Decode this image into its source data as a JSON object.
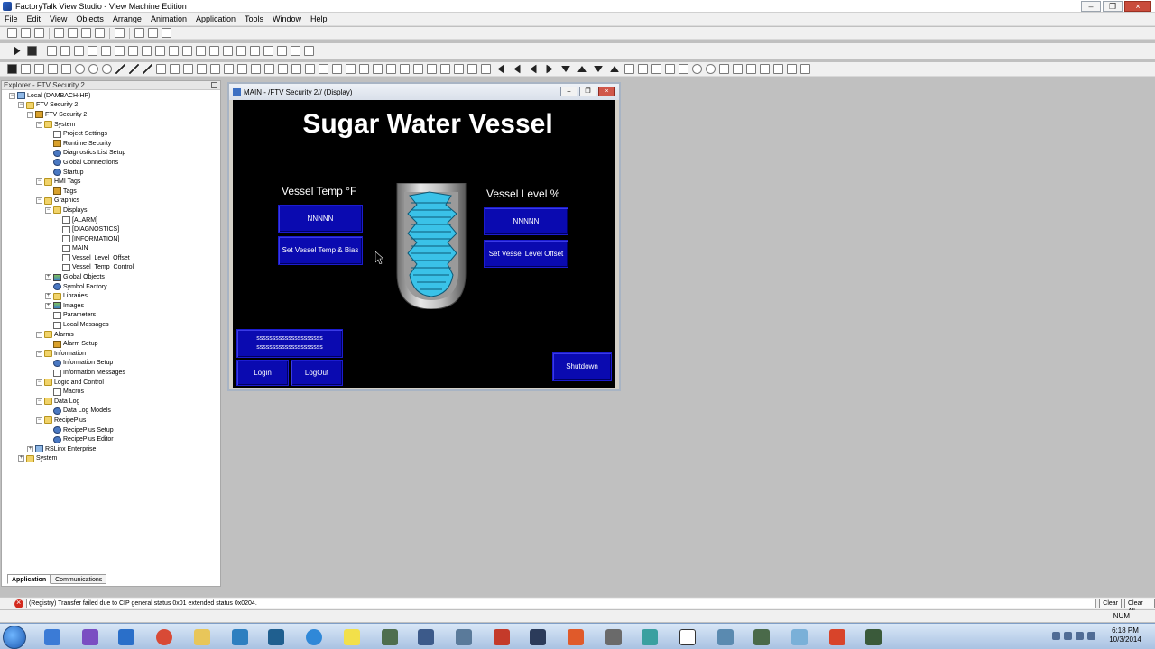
{
  "window": {
    "title": "FactoryTalk View Studio - View Machine Edition"
  },
  "menu": [
    "File",
    "Edit",
    "View",
    "Objects",
    "Arrange",
    "Animation",
    "Application",
    "Tools",
    "Window",
    "Help"
  ],
  "explorer": {
    "title": "Explorer - FTV Security 2",
    "tree": [
      {
        "label": "Local (DAMBACH-HP)",
        "depth": 0,
        "icon": "pc",
        "expander": "-"
      },
      {
        "label": "FTV Security 2",
        "depth": 1,
        "icon": "folder",
        "expander": "-"
      },
      {
        "label": "FTV Security 2",
        "depth": 2,
        "icon": "key",
        "expander": "-"
      },
      {
        "label": "System",
        "depth": 3,
        "icon": "folder",
        "expander": "-"
      },
      {
        "label": "Project Settings",
        "depth": 4,
        "icon": "doc",
        "expander": ""
      },
      {
        "label": "Runtime Security",
        "depth": 4,
        "icon": "key",
        "expander": ""
      },
      {
        "label": "Diagnostics List Setup",
        "depth": 4,
        "icon": "gear",
        "expander": ""
      },
      {
        "label": "Global Connections",
        "depth": 4,
        "icon": "gear",
        "expander": ""
      },
      {
        "label": "Startup",
        "depth": 4,
        "icon": "gear",
        "expander": ""
      },
      {
        "label": "HMI Tags",
        "depth": 3,
        "icon": "folder",
        "expander": "-"
      },
      {
        "label": "Tags",
        "depth": 4,
        "icon": "key",
        "expander": ""
      },
      {
        "label": "Graphics",
        "depth": 3,
        "icon": "folder",
        "expander": "-"
      },
      {
        "label": "Displays",
        "depth": 4,
        "icon": "folder",
        "expander": "-"
      },
      {
        "label": "[ALARM]",
        "depth": 5,
        "icon": "doc",
        "expander": ""
      },
      {
        "label": "[DIAGNOSTICS]",
        "depth": 5,
        "icon": "doc",
        "expander": ""
      },
      {
        "label": "[INFORMATION]",
        "depth": 5,
        "icon": "doc",
        "expander": ""
      },
      {
        "label": "MAIN",
        "depth": 5,
        "icon": "doc",
        "expander": ""
      },
      {
        "label": "Vessel_Level_Offset",
        "depth": 5,
        "icon": "doc",
        "expander": ""
      },
      {
        "label": "Vessel_Temp_Control",
        "depth": 5,
        "icon": "doc",
        "expander": ""
      },
      {
        "label": "Global Objects",
        "depth": 4,
        "icon": "img",
        "expander": "+"
      },
      {
        "label": "Symbol Factory",
        "depth": 4,
        "icon": "gear",
        "expander": ""
      },
      {
        "label": "Libraries",
        "depth": 4,
        "icon": "folder",
        "expander": "+"
      },
      {
        "label": "Images",
        "depth": 4,
        "icon": "img",
        "expander": "+"
      },
      {
        "label": "Parameters",
        "depth": 4,
        "icon": "doc",
        "expander": ""
      },
      {
        "label": "Local Messages",
        "depth": 4,
        "icon": "doc",
        "expander": ""
      },
      {
        "label": "Alarms",
        "depth": 3,
        "icon": "folder",
        "expander": "-"
      },
      {
        "label": "Alarm Setup",
        "depth": 4,
        "icon": "key",
        "expander": ""
      },
      {
        "label": "Information",
        "depth": 3,
        "icon": "folder",
        "expander": "-"
      },
      {
        "label": "Information Setup",
        "depth": 4,
        "icon": "gear",
        "expander": ""
      },
      {
        "label": "Information Messages",
        "depth": 4,
        "icon": "doc",
        "expander": ""
      },
      {
        "label": "Logic and Control",
        "depth": 3,
        "icon": "folder",
        "expander": "-"
      },
      {
        "label": "Macros",
        "depth": 4,
        "icon": "doc",
        "expander": ""
      },
      {
        "label": "Data Log",
        "depth": 3,
        "icon": "folder",
        "expander": "-"
      },
      {
        "label": "Data Log Models",
        "depth": 4,
        "icon": "gear",
        "expander": ""
      },
      {
        "label": "RecipePlus",
        "depth": 3,
        "icon": "folder",
        "expander": "-"
      },
      {
        "label": "RecipePlus Setup",
        "depth": 4,
        "icon": "gear",
        "expander": ""
      },
      {
        "label": "RecipePlus Editor",
        "depth": 4,
        "icon": "gear",
        "expander": ""
      },
      {
        "label": "RSLinx Enterprise",
        "depth": 2,
        "icon": "pc",
        "expander": "+"
      },
      {
        "label": "System",
        "depth": 1,
        "icon": "folder",
        "expander": "+"
      }
    ],
    "tabs": [
      "Application",
      "Communications"
    ]
  },
  "display": {
    "title": "MAIN - /FTV Security 2// (Display)",
    "heading": "Sugar Water Vessel",
    "temp_label": "Vessel Temp °F",
    "temp_value": "NNNNN",
    "temp_button": "Set Vessel Temp & Bias",
    "level_label": "Vessel Level %",
    "level_value": "NNNNN",
    "level_button": "Set Vessel Level Offset",
    "user_line1": "sssssssssssssssssssss",
    "user_line2": "sssssssssssssssssssss",
    "login": "Login",
    "logout": "LogOut",
    "shutdown": "Shutdown"
  },
  "status": {
    "message": "(Registry) Transfer failed due to CIP general status 0x01 extended status 0x0204.",
    "clear": "Clear",
    "clear_all": "Clear All",
    "num": "NUM"
  },
  "taskbar": {
    "time": "6:18 PM",
    "date": "10/3/2014"
  },
  "colors": {
    "hmi_button": "#0a0ab0",
    "vessel_fluid": "#3ac2e8",
    "canvas": "#000000"
  }
}
